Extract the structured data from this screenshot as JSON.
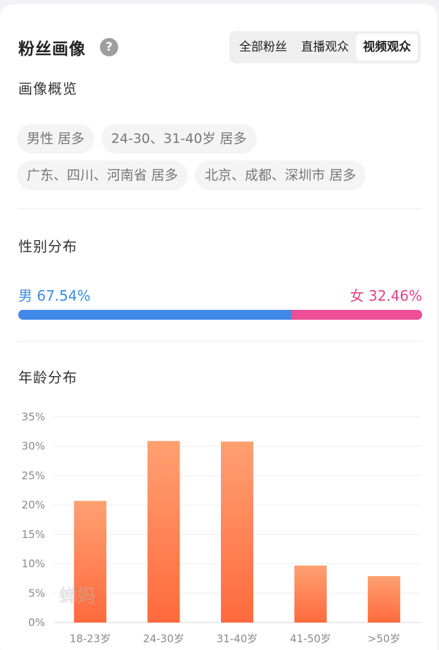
{
  "header": {
    "title": "粉丝画像",
    "tabs": [
      {
        "label": "全部粉丝",
        "active": false
      },
      {
        "label": "直播观众",
        "active": false
      },
      {
        "label": "视频观众",
        "active": true
      }
    ]
  },
  "overview": {
    "title": "画像概览",
    "tags": [
      [
        "男性 居多",
        "24-30、31-40岁 居多"
      ],
      [
        "广东、四川、河南省 居多",
        "北京、成都、深圳市 居多"
      ]
    ]
  },
  "gender": {
    "title": "性别分布",
    "male_label": "男 67.54%",
    "female_label": "女 32.46%",
    "male_pct": 67.54,
    "female_pct": 32.46,
    "male_color": "#3f88e8",
    "female_color": "#ec4f95"
  },
  "age": {
    "title": "年龄分布"
  },
  "watermark": "蝉妈",
  "chart_data": {
    "type": "bar",
    "categories": [
      "18-23岁",
      "24-30岁",
      "31-40岁",
      "41-50岁",
      ">50岁"
    ],
    "values": [
      20.7,
      30.9,
      30.8,
      9.7,
      7.9
    ],
    "ylim": [
      0,
      35
    ],
    "yticks": [
      "0%",
      "5%",
      "10%",
      "15%",
      "20%",
      "25%",
      "30%",
      "35%"
    ],
    "grid": true,
    "bar_color_top": "#ffa071",
    "bar_color_bottom": "#ff6a3d"
  }
}
